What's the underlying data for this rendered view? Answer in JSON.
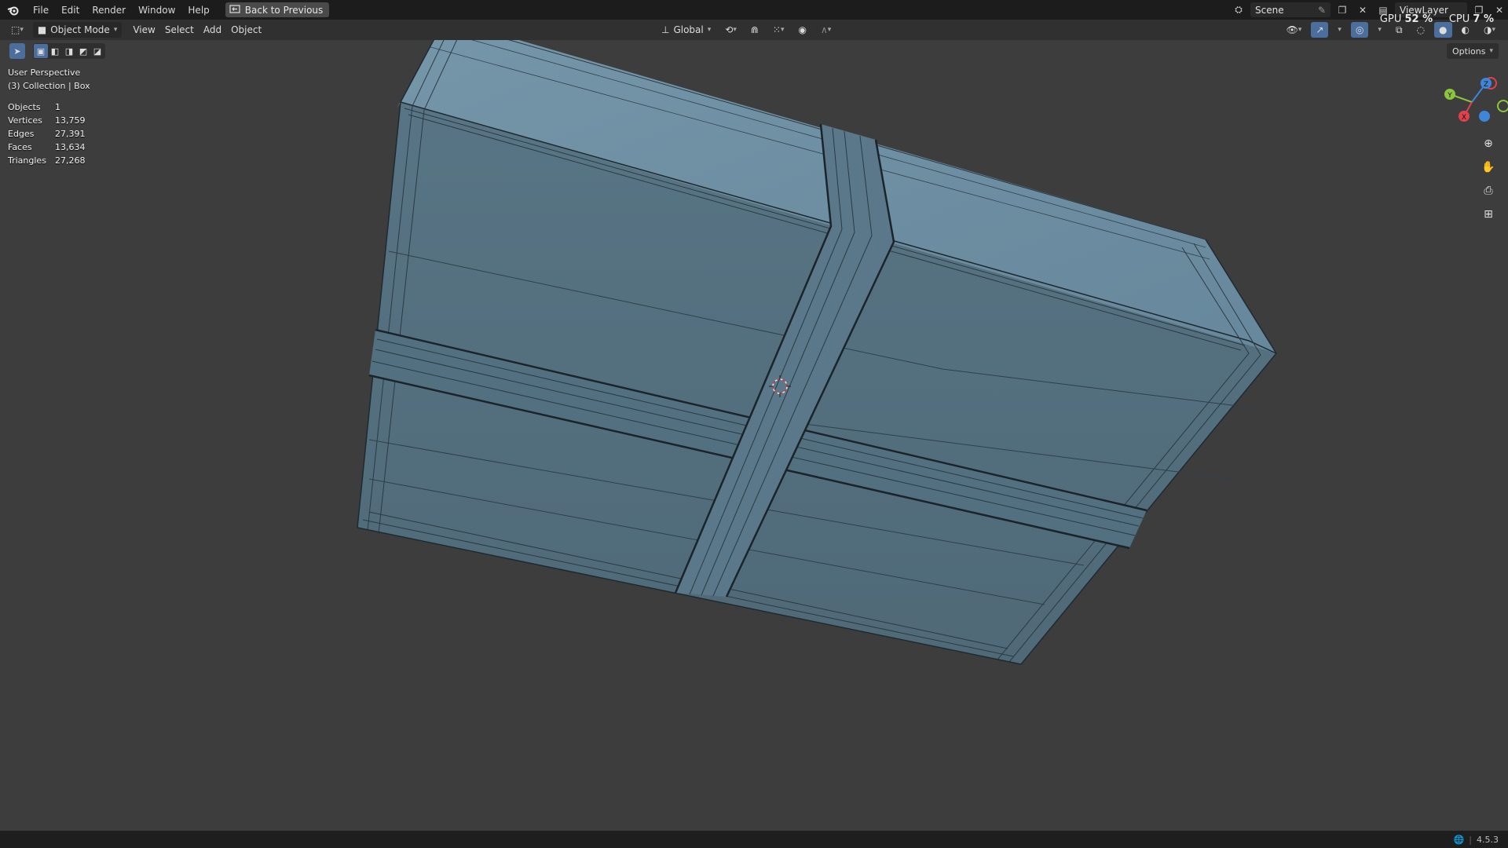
{
  "menu": [
    "File",
    "Edit",
    "Render",
    "Window",
    "Help"
  ],
  "back_button": "Back to Previous",
  "scene": "Scene",
  "view_layer": "ViewLayer",
  "perf": {
    "gpu_label": "GPU",
    "gpu_value": "52 %",
    "cpu_label": "CPU",
    "cpu_value": "7 %"
  },
  "header": {
    "mode": "Object Mode",
    "menus": [
      "View",
      "Select",
      "Add",
      "Object"
    ],
    "orientation": "Global"
  },
  "options_label": "Options",
  "overlay": {
    "perspective": "User Perspective",
    "collection": "(3) Collection | Box",
    "stats": [
      {
        "label": "Objects",
        "value": "1"
      },
      {
        "label": "Vertices",
        "value": "13,759"
      },
      {
        "label": "Edges",
        "value": "27,391"
      },
      {
        "label": "Faces",
        "value": "13,634"
      },
      {
        "label": "Triangles",
        "value": "27,268"
      }
    ]
  },
  "gizmo": {
    "x": "X",
    "y": "Y",
    "z": "Z"
  },
  "version": "4.5.3",
  "colors": {
    "mesh_top": "#6e8ea2",
    "mesh_front": "#55707f",
    "viewport_bg": "#3d3d3d",
    "axis_x": "#e0424d",
    "axis_y": "#8cc63e",
    "axis_z": "#3e86d9"
  }
}
